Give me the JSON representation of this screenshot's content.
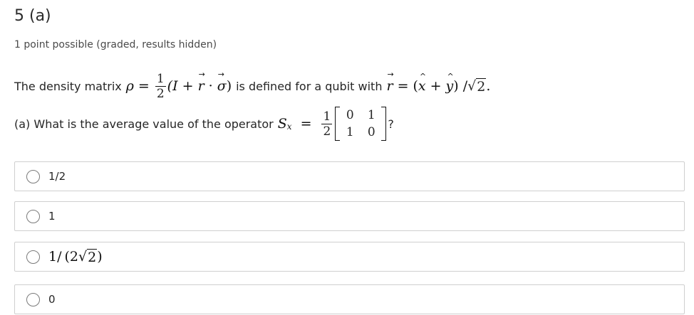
{
  "problem": {
    "title": "5 (a)",
    "meta": "1 point possible (graded, results hidden)"
  },
  "question": {
    "line1_intro": "The density matrix",
    "rho": "ρ",
    "eq": "=",
    "frac_num": "1",
    "frac_den": "2",
    "expr_open": "(I +",
    "r_vec": "r",
    "dot": "·",
    "sigma_vec": "σ",
    "expr_close": ")",
    "line1_mid": "is defined for a qubit with",
    "r_vec2": "r",
    "eq2": "=",
    "paren_open": "(",
    "x_hat": "x",
    "plus": "+",
    "y_hat": "y",
    "paren_close": ")",
    "slash": "/",
    "sqrt2": "2",
    "period": ".",
    "line2_intro": "(a) What is the average value of the operator",
    "S": "S",
    "S_sub": "x",
    "eq3": "=",
    "mat_frac_num": "1",
    "mat_frac_den": "2",
    "matrix": [
      "0",
      "1",
      "1",
      "0"
    ],
    "question_mark": "?"
  },
  "choices": [
    {
      "label": "1/2"
    },
    {
      "label": "1"
    },
    {
      "label_prefix": "1/",
      "label_open": "(2",
      "label_sqrt": "2",
      "label_close": ")"
    },
    {
      "label": "0"
    }
  ]
}
